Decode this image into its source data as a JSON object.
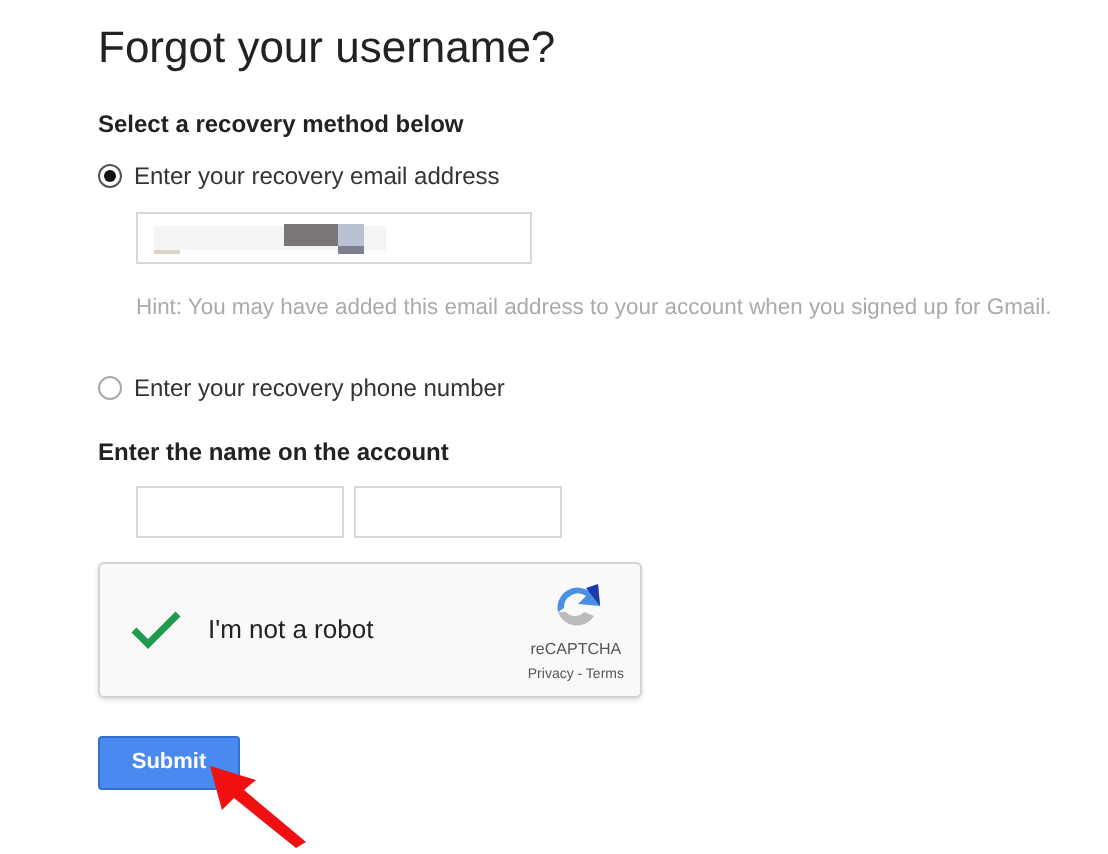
{
  "title": "Forgot your username?",
  "method_heading": "Select a recovery method below",
  "methods": [
    {
      "kind": "email",
      "label": "Enter your recovery email address",
      "selected": true,
      "hint": "Hint: You may have added this email address to your account when you signed up for Gmail."
    },
    {
      "kind": "phone",
      "label": "Enter your recovery phone number",
      "selected": false
    }
  ],
  "name_heading": "Enter the name on the account",
  "captcha": {
    "label": "I'm not a robot",
    "checked": true,
    "brand": "reCAPTCHA",
    "links": "Privacy - Terms"
  },
  "submit": "Submit"
}
